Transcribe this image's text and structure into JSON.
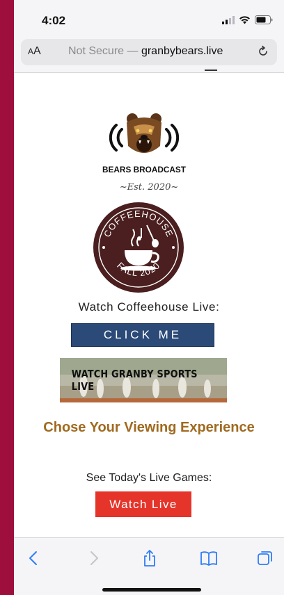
{
  "status_bar": {
    "time": "4:02"
  },
  "url_bar": {
    "aa_label_small": "A",
    "aa_label_large": "A",
    "security_text": "Not Secure — ",
    "domain": "granbybears.live"
  },
  "page": {
    "logo": {
      "name_text": "BEARS BROADCAST"
    },
    "est_text": "~Est. 2020~",
    "coffeehouse_badge": {
      "top_text": "COFFEEHOUSE",
      "bottom_text": "FALL 2020"
    },
    "watch_coffeehouse_label": "Watch Coffeehouse Live:",
    "click_me_button": "CLICK ME",
    "sports_banner_text": "WATCH GRANBY SPORTS LIVE",
    "viewing_heading": "Chose Your Viewing Experience",
    "todays_games_label": "See Today's Live Games:",
    "watch_live_button": "Watch Live"
  },
  "icons": {
    "menu": "hamburger-menu-icon",
    "reload": "reload-icon",
    "back": "chevron-left-icon",
    "forward": "chevron-right-icon",
    "share": "share-icon",
    "bookmarks": "book-icon",
    "tabs": "tabs-icon"
  },
  "colors": {
    "background_border": "#9e0f3e",
    "click_me_button": "#2b4a77",
    "watch_live_button": "#e5342a",
    "heading": "#a06a1f",
    "ios_blue": "#2f7cf6"
  }
}
